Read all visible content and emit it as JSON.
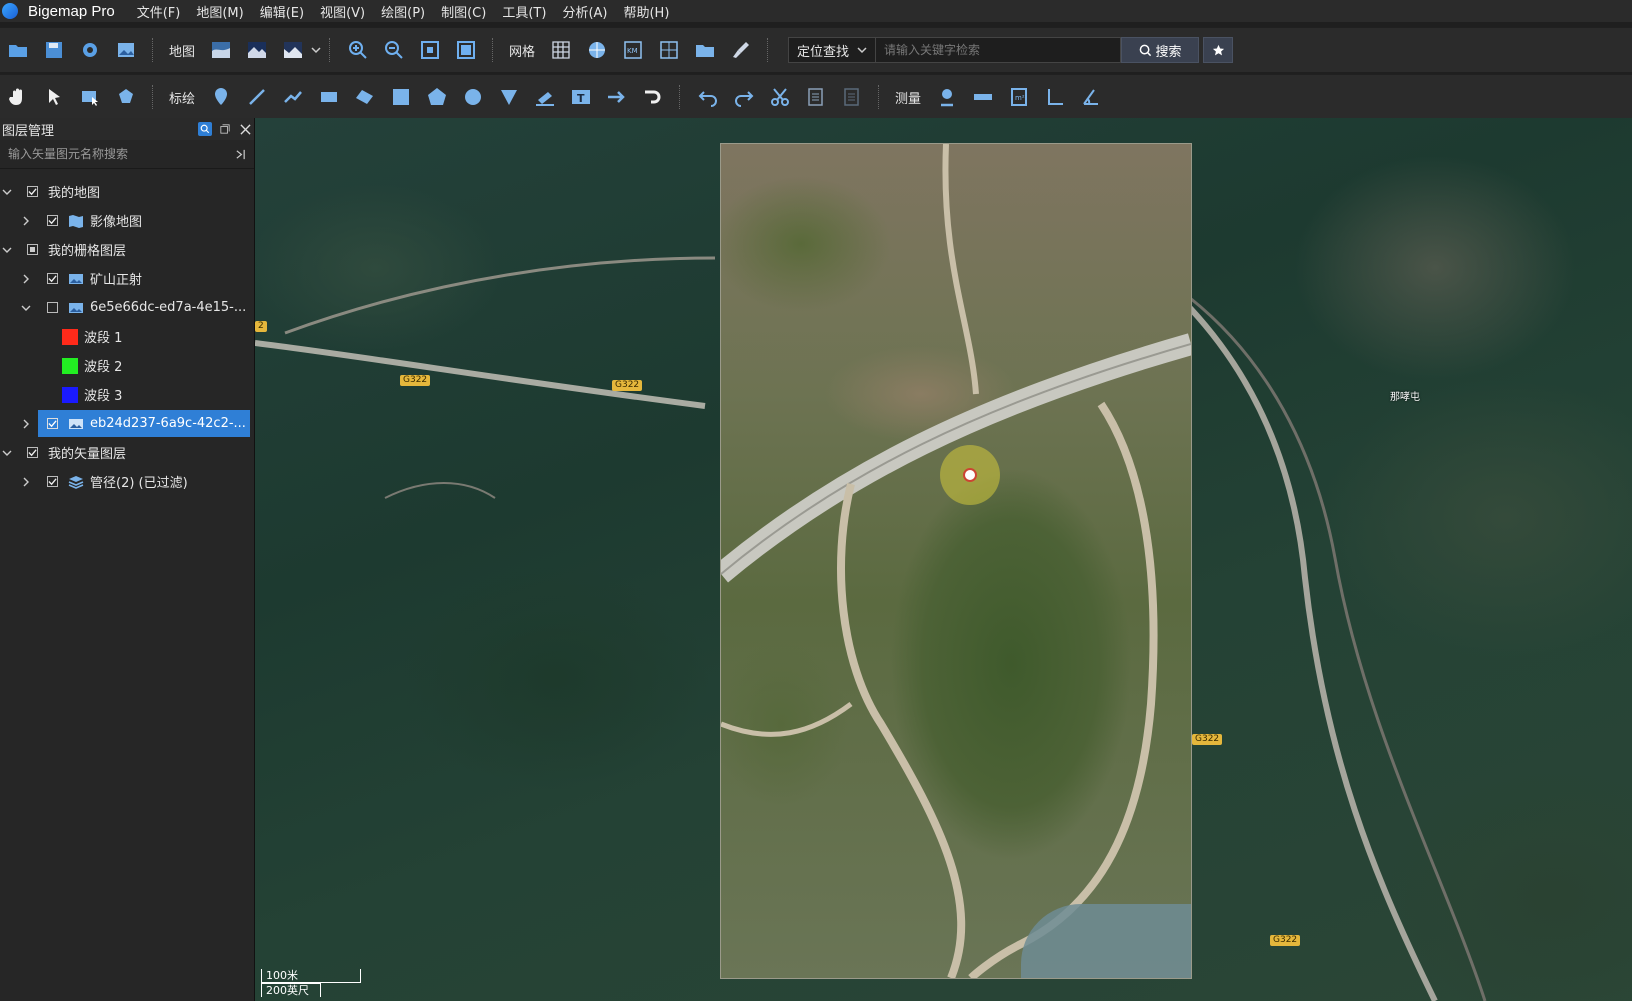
{
  "app": {
    "title": "Bigemap Pro"
  },
  "menu": [
    "文件(F)",
    "地图(M)",
    "编辑(E)",
    "视图(V)",
    "绘图(P)",
    "制图(C)",
    "工具(T)",
    "分析(A)",
    "帮助(H)"
  ],
  "toolbar1": {
    "map_label": "地图",
    "grid_label": "网格",
    "search_type": "定位查找",
    "search_placeholder": "请输入关键字检索",
    "search_button": "搜索"
  },
  "toolbar2": {
    "draw_label": "标绘",
    "measure_label": "测量"
  },
  "layer_panel": {
    "title": "图层管理",
    "search_placeholder": "输入矢量图元名称搜索",
    "items": [
      {
        "label": "我的地图",
        "level": 0,
        "expanded": true,
        "checked": true
      },
      {
        "label": "影像地图",
        "level": 1,
        "expanded": false,
        "checked": true
      },
      {
        "label": "我的栅格图层",
        "level": 0,
        "expanded": true,
        "checked": "partial"
      },
      {
        "label": "矿山正射",
        "level": 1,
        "expanded": false,
        "checked": true
      },
      {
        "label": "6e5e66dc-ed7a-4e15-...",
        "level": 1,
        "expanded": true,
        "checked": false
      },
      {
        "label": "波段 1",
        "level": 2,
        "color": "#ff2a1a"
      },
      {
        "label": "波段 2",
        "level": 2,
        "color": "#22ee22"
      },
      {
        "label": "波段 3",
        "level": 2,
        "color": "#1a1aff"
      },
      {
        "label": "eb24d237-6a9c-42c2-...",
        "level": 1,
        "expanded": false,
        "checked": true,
        "selected": true
      },
      {
        "label": "我的矢量图层",
        "level": 0,
        "expanded": true,
        "checked": true
      },
      {
        "label": "管径(2) (已过滤)",
        "level": 1,
        "expanded": false,
        "checked": true
      }
    ]
  },
  "map": {
    "road_badges": [
      "2",
      "G322",
      "G322",
      "G322",
      "G322"
    ],
    "place": "那哮屯",
    "scale": {
      "metric": "100米",
      "imperial": "200英尺"
    }
  }
}
